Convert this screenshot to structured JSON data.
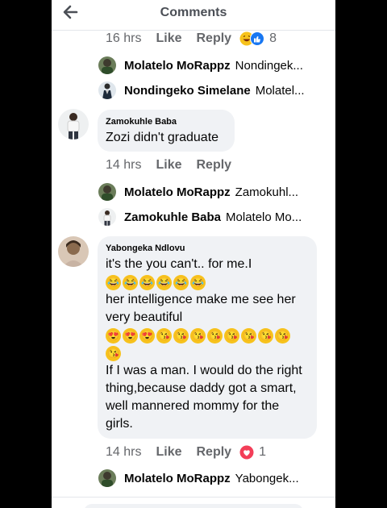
{
  "header": {
    "title": "Comments",
    "back_icon": "arrow-left-icon"
  },
  "thread1": {
    "time": "16 hrs",
    "like": "Like",
    "reply": "Reply",
    "reaction_count": "8",
    "reactions": [
      "laugh-react-icon",
      "like-react-icon"
    ],
    "replies": [
      {
        "name": "Molatelo MoRappz",
        "preview": "Nondingek..."
      },
      {
        "name": "Nondingeko Simelane",
        "preview": "Molatel..."
      }
    ]
  },
  "comment2": {
    "author": "Zamokuhle Baba",
    "text": "Zozi didn't graduate",
    "time": "14 hrs",
    "like": "Like",
    "reply": "Reply",
    "replies": [
      {
        "name": "Molatelo MoRappz",
        "preview": "Zamokuhl..."
      },
      {
        "name": "Zamokuhle Baba",
        "preview": "Molatelo Mo..."
      }
    ]
  },
  "comment3": {
    "author": "Yabongeka Ndlovu",
    "line1": "it's the you can't..  for me.I",
    "emoji_row1": [
      "😂",
      "😂",
      "😂",
      "😂",
      "😂",
      "😂"
    ],
    "line2": "her intelligence make me see her",
    "line3": "very beautiful",
    "emoji_row2": [
      "😍",
      "😍",
      "😍",
      "😘",
      "😘",
      "😘",
      "😘",
      "😘",
      "😘",
      "😘",
      "😘"
    ],
    "emoji_row3": [
      "😘"
    ],
    "line4": "If I was a man.  I would do the right",
    "line5": "thing,because daddy got a smart,",
    "line6": "well mannered mommy for the",
    "line7": "girls.",
    "time": "14 hrs",
    "like": "Like",
    "reply": "Reply",
    "reaction_count": "1",
    "reactions": [
      "love-react-icon"
    ],
    "replies": [
      {
        "name": "Molatelo MoRappz",
        "preview": "Yabongek..."
      }
    ]
  },
  "colors": {
    "meta_gray": "#65676b",
    "bubble_bg": "#f0f2f5",
    "love_red": "#f33e58",
    "like_blue": "#1877f2",
    "emoji_yellow": "#f7c21c"
  }
}
